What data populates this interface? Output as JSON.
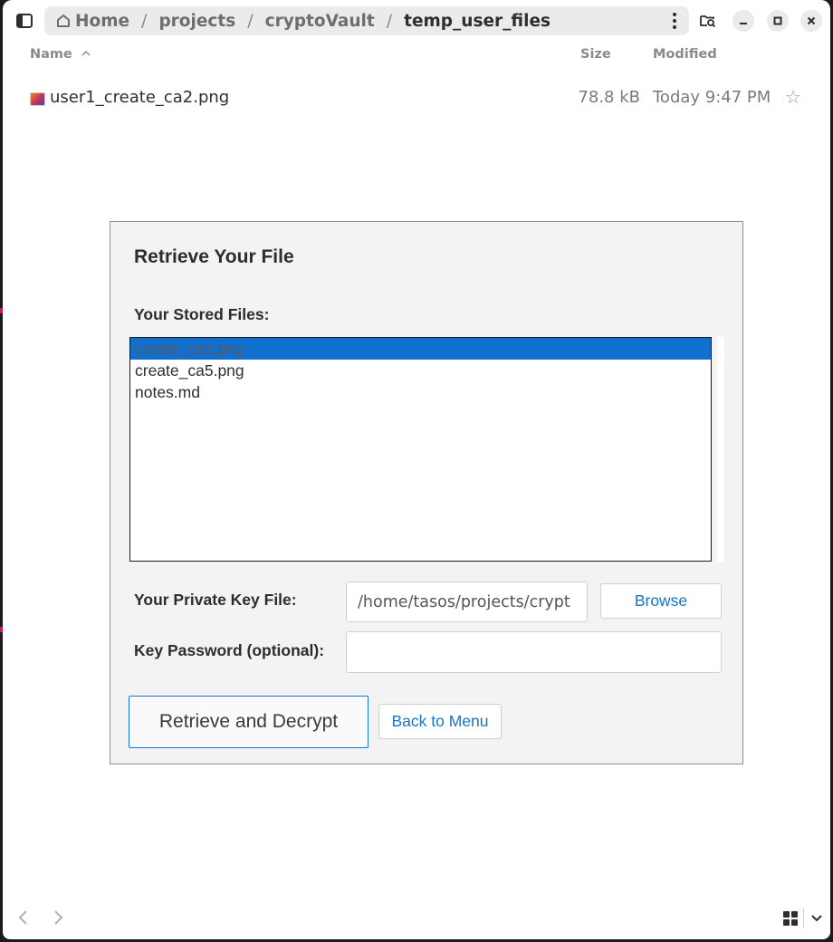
{
  "breadcrumb": {
    "items": [
      "Home",
      "projects",
      "cryptoVault",
      "temp_user_files"
    ],
    "separator": "/"
  },
  "columns": {
    "name": "Name",
    "size": "Size",
    "modified": "Modified"
  },
  "files": [
    {
      "name": "user1_create_ca2.png",
      "size": "78.8 kB",
      "modified": "Today 9:47 PM"
    }
  ],
  "dialog": {
    "title": "Retrieve Your File",
    "stored_files_label": "Your Stored Files:",
    "stored_files": [
      "create_ca2.png",
      "create_ca5.png",
      "notes.md"
    ],
    "selected_index": 0,
    "private_key_label": "Your Private Key File:",
    "private_key_value": "/home/tasos/projects/crypt",
    "browse_label": "Browse",
    "password_label": "Key Password (optional):",
    "password_value": "",
    "retrieve_label": "Retrieve and Decrypt",
    "back_label": "Back to Menu"
  },
  "colors": {
    "accent": "#1170cf",
    "link_text": "#1676c6"
  },
  "icons": [
    "sidebar-toggle-icon",
    "home-icon",
    "more-options-icon",
    "search-folder-icon",
    "minimize-icon",
    "maximize-icon",
    "close-icon",
    "sort-ascending-icon",
    "image-file-icon",
    "star-icon",
    "back-arrow-icon",
    "forward-arrow-icon",
    "grid-view-icon",
    "chevron-down-icon"
  ]
}
